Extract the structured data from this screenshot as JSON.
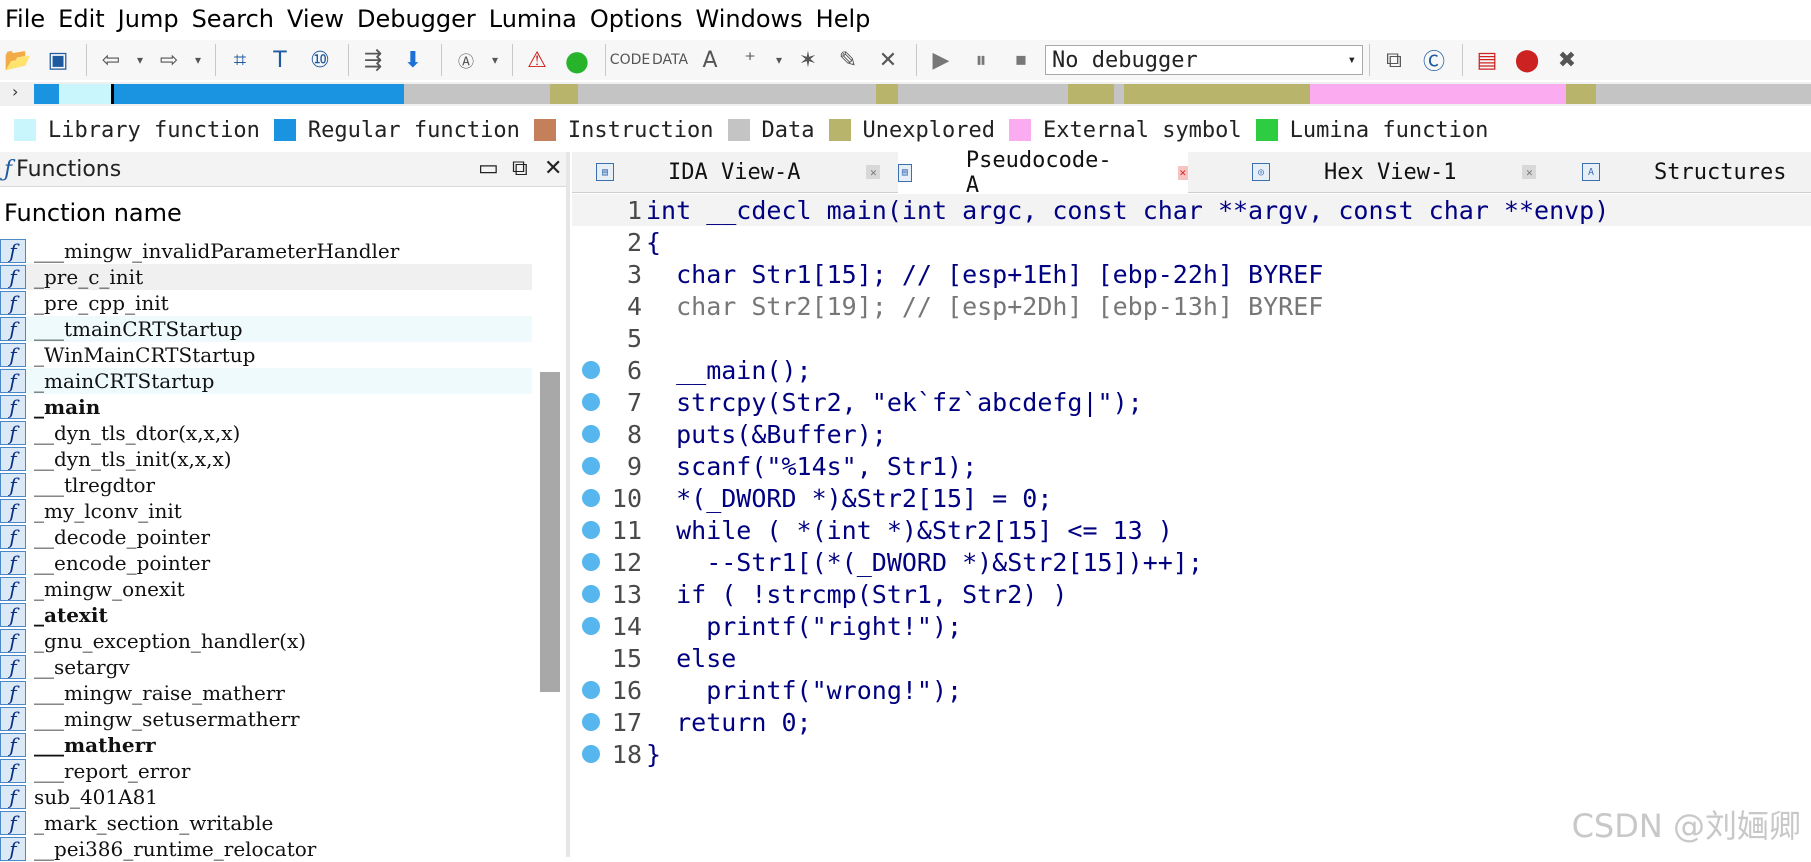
{
  "menu": [
    "File",
    "Edit",
    "Jump",
    "Search",
    "View",
    "Debugger",
    "Lumina",
    "Options",
    "Windows",
    "Help"
  ],
  "toolbar": {
    "debugger_select": "No debugger",
    "icons": [
      "open-icon",
      "save-icon",
      "back-icon",
      "forward-icon",
      "search-binary-icon",
      "search-text-icon",
      "search-immediate-icon",
      "jump-icon",
      "download-icon",
      "ascii-icon",
      "warning-icon",
      "green-circle-icon",
      "code-icon",
      "data-icon",
      "string-icon",
      "offset-icon",
      "struct-icon",
      "rename-icon",
      "undefine-icon",
      "play-icon",
      "pause-icon",
      "stop-icon",
      "graph-icon",
      "pseudocode-icon",
      "xref-icon",
      "breakpoint-icon",
      "tools-icon"
    ]
  },
  "legend": [
    {
      "label": "Library function",
      "color": "#c9f5fc"
    },
    {
      "label": "Regular function",
      "color": "#1a94e0"
    },
    {
      "label": "Instruction",
      "color": "#c4805a"
    },
    {
      "label": "Data",
      "color": "#c4c4c4"
    },
    {
      "label": "Unexplored",
      "color": "#b8b46c"
    },
    {
      "label": "External symbol",
      "color": "#fbabf0"
    },
    {
      "label": "Lumina function",
      "color": "#2ecc40"
    }
  ],
  "functions_pane": {
    "title": "Functions",
    "column_header": "Function name",
    "items": [
      {
        "name": "___mingw_invalidParameterHandler"
      },
      {
        "name": "_pre_c_init"
      },
      {
        "name": "_pre_cpp_init"
      },
      {
        "name": "___tmainCRTStartup"
      },
      {
        "name": "_WinMainCRTStartup"
      },
      {
        "name": "_mainCRTStartup"
      },
      {
        "name": "_main"
      },
      {
        "name": "__dyn_tls_dtor(x,x,x)"
      },
      {
        "name": "__dyn_tls_init(x,x,x)"
      },
      {
        "name": "___tlregdtor"
      },
      {
        "name": "_my_lconv_init"
      },
      {
        "name": "__decode_pointer"
      },
      {
        "name": "__encode_pointer"
      },
      {
        "name": "_mingw_onexit"
      },
      {
        "name": "_atexit"
      },
      {
        "name": "_gnu_exception_handler(x)"
      },
      {
        "name": "__setargv"
      },
      {
        "name": "___mingw_raise_matherr"
      },
      {
        "name": "___mingw_setusermatherr"
      },
      {
        "name": "___matherr"
      },
      {
        "name": "___report_error"
      },
      {
        "name": "sub_401A81"
      },
      {
        "name": "_mark_section_writable"
      },
      {
        "name": "__pei386_runtime_relocator"
      }
    ]
  },
  "tabs": [
    {
      "label": "IDA View-A"
    },
    {
      "label": "Pseudocode-A"
    },
    {
      "label": "Hex View-1"
    },
    {
      "label": "Structures"
    }
  ],
  "code": {
    "line_numbers": [
      "1",
      "2",
      "3",
      "4",
      "5",
      "6",
      "7",
      "8",
      "9",
      "10",
      "11",
      "12",
      "13",
      "14",
      "15",
      "16",
      "17",
      "18"
    ],
    "lines": [
      "int __cdecl main(int argc, const char **argv, const char **envp)",
      "{",
      "  char Str1[15]; // [esp+1Eh] [ebp-22h] BYREF",
      "  char Str2[19]; // [esp+2Dh] [ebp-13h] BYREF",
      "",
      "  __main();",
      "  strcpy(Str2, \"ek`fz`abcdefg|\");",
      "  puts(&Buffer);",
      "  scanf(\"%14s\", Str1);",
      "  *(_DWORD *)&Str2[15] = 0;",
      "  while ( *(int *)&Str2[15] <= 13 )",
      "    --Str1[(*(_DWORD *)&Str2[15])++];",
      "  if ( !strcmp(Str1, Str2) )",
      "    printf(\"right!\");",
      "  else",
      "    printf(\"wrong!\");",
      "  return 0;",
      "}"
    ]
  },
  "watermark": "CSDN @刘婳卿"
}
